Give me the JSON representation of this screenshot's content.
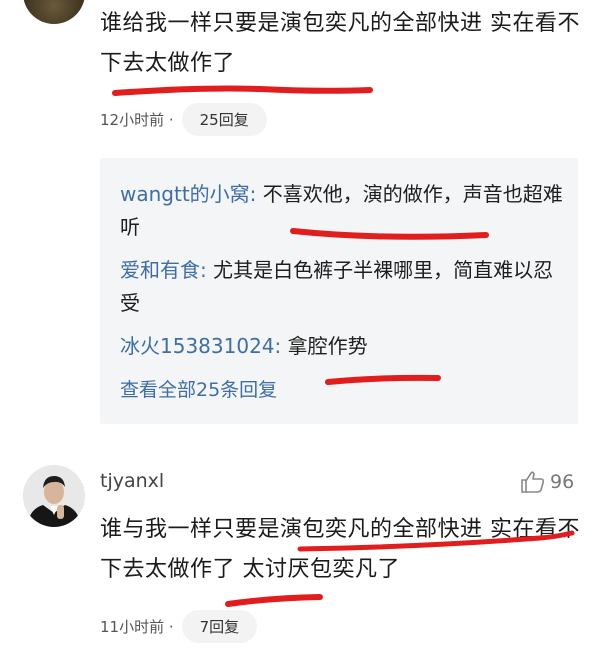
{
  "comment1": {
    "text": "谁给我一样只要是演包奕凡的全部快进 实在看不下去太做作了",
    "time": "12小时前 ·",
    "reply_count": "25回复"
  },
  "replies": [
    {
      "user": "wangtt的小窝:",
      "text": " 不喜欢他，演的做作，声音也超难听"
    },
    {
      "user": "爱和有食:",
      "text": " 尤其是白色裤子半裸哪里，简直难以忍受"
    },
    {
      "user": "冰火153831024:",
      "text": " 拿腔作势"
    }
  ],
  "view_all": "查看全部25条回复",
  "comment2": {
    "username": "tjyanxl",
    "likes": "96",
    "text": "谁与我一样只要是演包奕凡的全部快进 实在看不下去太做作了 太讨厌包奕凡了",
    "time": "11小时前 ·",
    "reply_count": "7回复"
  },
  "colors": {
    "link_blue": "#3f6ea3",
    "marker_red": "#e11d1d",
    "reply_bg": "#f4f5f7"
  },
  "icons": {
    "like": "thumbs-up-icon"
  }
}
